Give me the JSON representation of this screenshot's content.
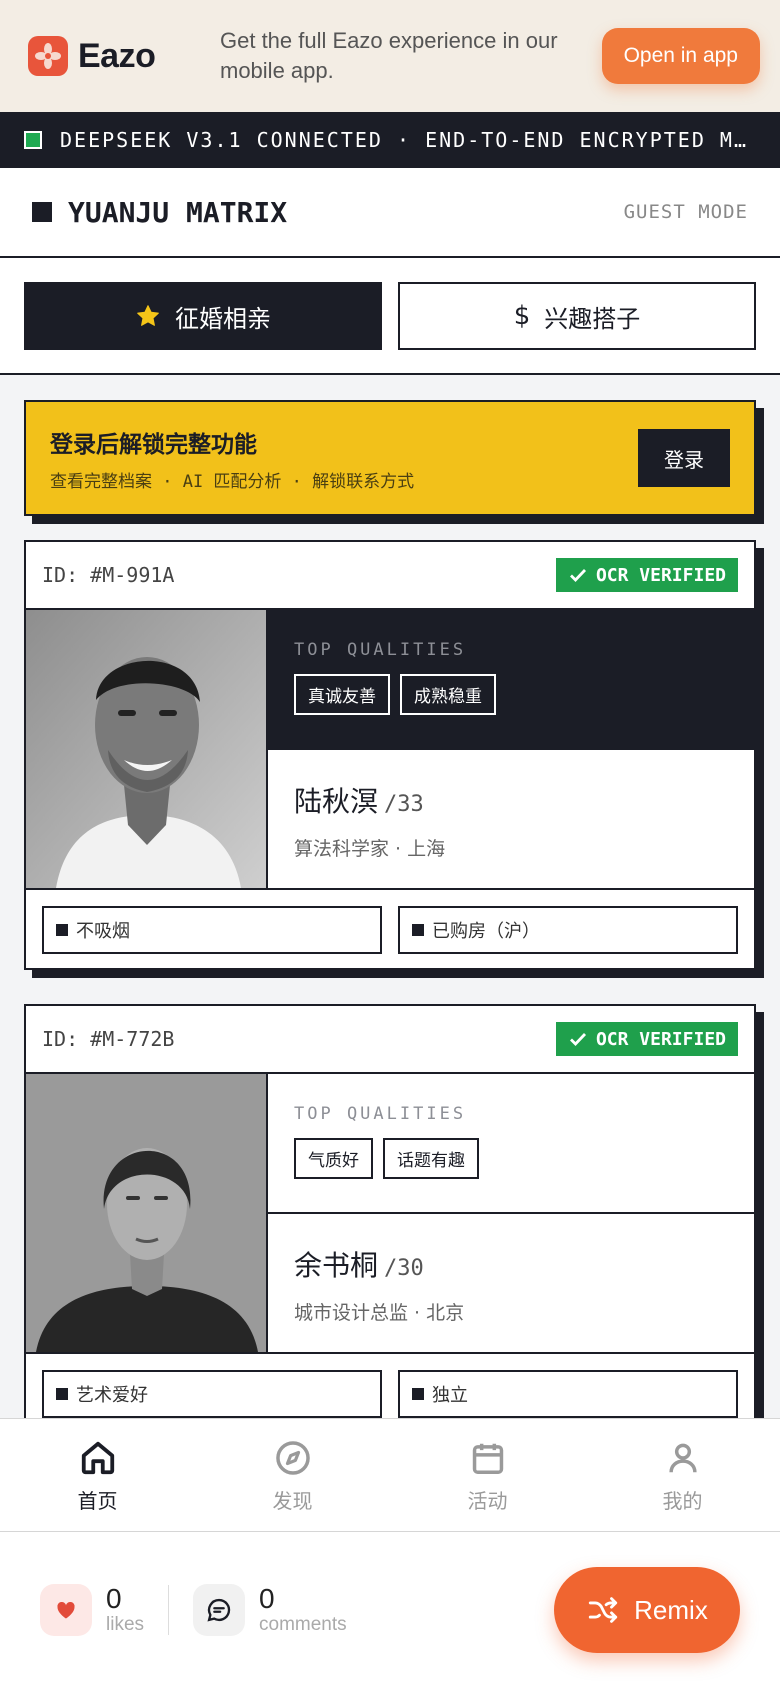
{
  "promo": {
    "logo_text": "Eazo",
    "message": "Get the full Eazo experience in our mobile app.",
    "open_label": "Open in app"
  },
  "ticker": {
    "text": "DEEPSEEK V3.1 CONNECTED · END-TO-END ENCRYPTED M…"
  },
  "header": {
    "brand": "YUANJU MATRIX",
    "mode": "GUEST MODE"
  },
  "tabs": [
    {
      "label": "征婚相亲",
      "icon": "star-icon",
      "active": true
    },
    {
      "label": "兴趣搭子",
      "icon": "dollar-icon",
      "active": false
    }
  ],
  "login_banner": {
    "title": "登录后解锁完整功能",
    "subtitle": "查看完整档案 · AI 匹配分析 · 解锁联系方式",
    "button": "登录"
  },
  "profiles": [
    {
      "id": "ID: #M-991A",
      "verified": "OCR VERIFIED",
      "qualities_label": "TOP QUALITIES",
      "qualities": [
        "真诚友善",
        "成熟稳重"
      ],
      "name": "陆秋溟",
      "age": "/33",
      "meta": "算法科学家 · 上海",
      "traits": [
        "不吸烟",
        "已购房（沪）"
      ]
    },
    {
      "id": "ID: #M-772B",
      "verified": "OCR VERIFIED",
      "qualities_label": "TOP QUALITIES",
      "qualities": [
        "气质好",
        "话题有趣"
      ],
      "name": "余书桐",
      "age": "/30",
      "meta": "城市设计总监 · 北京",
      "traits": [
        "艺术爱好",
        "独立"
      ]
    }
  ],
  "nav": [
    {
      "label": "首页",
      "icon": "home-icon",
      "active": true
    },
    {
      "label": "发现",
      "icon": "compass-icon",
      "active": false
    },
    {
      "label": "活动",
      "icon": "calendar-icon",
      "active": false
    },
    {
      "label": "我的",
      "icon": "user-icon",
      "active": false
    }
  ],
  "footer": {
    "likes_count": "0",
    "likes_label": "likes",
    "comments_count": "0",
    "comments_label": "comments",
    "remix_label": "Remix"
  },
  "colors": {
    "ink": "#1b1d26",
    "accent_orange": "#f06530",
    "banner_yellow": "#f2c11a",
    "verified_green": "#1fa04c"
  }
}
